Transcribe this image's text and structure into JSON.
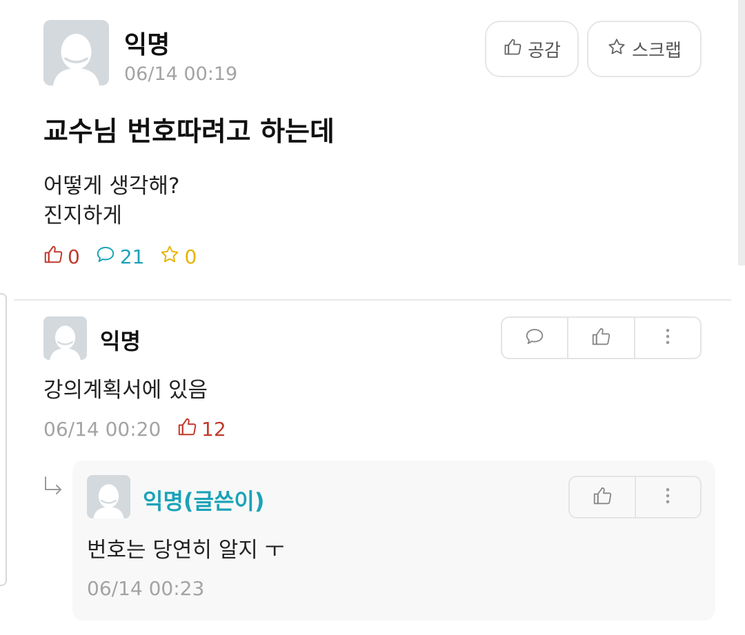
{
  "post": {
    "author": "익명",
    "timestamp": "06/14 00:19",
    "title": "교수님 번호따려고 하는데",
    "body_line1": "어떻게 생각해?",
    "body_line2": "진지하게",
    "like_button_label": "공감",
    "scrap_button_label": "스크랩",
    "like_count": "0",
    "comment_count": "21",
    "scrap_count": "0"
  },
  "comment": {
    "author": "익명",
    "body": "강의계획서에 있음",
    "timestamp": "06/14 00:20",
    "like_count": "12"
  },
  "reply": {
    "author": "익명(글쓴이)",
    "body": "번호는 당연히 알지 ㅜ",
    "timestamp": "06/14 00:23"
  },
  "colors": {
    "like_red": "#c0392b",
    "comment_teal": "#1aa3b8",
    "scrap_yellow": "#e8b400",
    "op_author_teal": "#1aa3b8"
  },
  "icons": [
    "thumbs-up-icon",
    "star-icon",
    "speech-bubble-icon",
    "more-vertical-icon",
    "reply-arrow-icon"
  ]
}
